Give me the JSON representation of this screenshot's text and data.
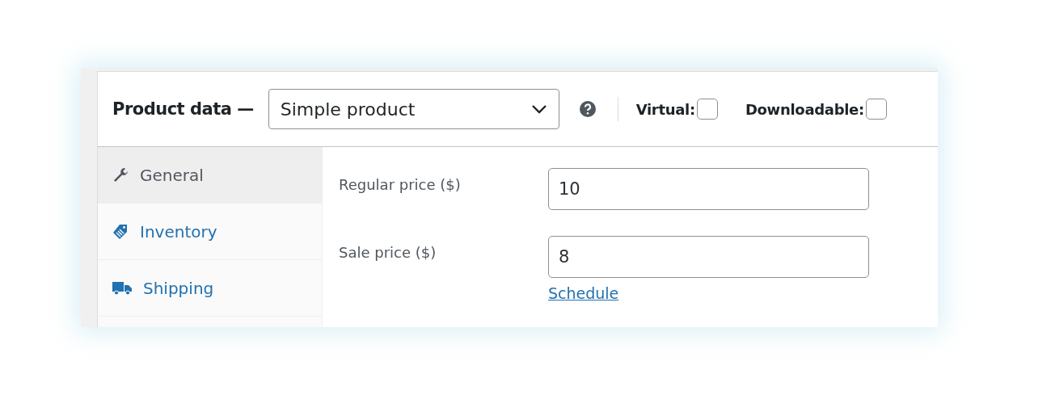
{
  "header": {
    "title": "Product data —",
    "product_type": "Simple product",
    "options": [
      {
        "label": "Virtual:",
        "checked": false
      },
      {
        "label": "Downloadable:",
        "checked": false
      }
    ]
  },
  "tabs": [
    {
      "label": "General",
      "kind": "wrench",
      "selected": true
    },
    {
      "label": "Inventory",
      "kind": "tag",
      "selected": false
    },
    {
      "label": "Shipping",
      "kind": "truck",
      "selected": false
    }
  ],
  "fields": [
    {
      "label": "Regular price ($)",
      "value": "10"
    },
    {
      "label": "Sale price ($)",
      "value": "8",
      "link": "Schedule"
    }
  ]
}
